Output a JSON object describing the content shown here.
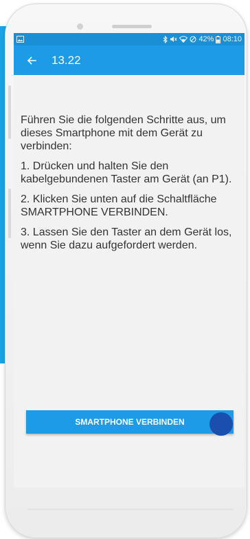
{
  "status_bar": {
    "battery": "42%",
    "time": "08:10",
    "icons": [
      "image-icon",
      "bluetooth-icon",
      "mute-icon",
      "wifi-icon",
      "alarm-off-icon",
      "battery-icon"
    ]
  },
  "app_bar": {
    "back_icon": "arrow-left-icon",
    "title": "13.22"
  },
  "instructions": {
    "intro": "Führen Sie die folgenden Schritte aus, um dieses Smartphone mit dem Gerät zu verbinden:",
    "steps": [
      "1. Drücken und halten Sie den kabelgebundenen Taster am Gerät (an P1).",
      "2. Klicken Sie unten auf die Schaltfläche SMARTPHONE VERBINDEN.",
      "3. Lassen Sie den Taster an dem Gerät los, wenn Sie dazu aufgefordert werden."
    ]
  },
  "connect_button": {
    "label": "SMARTPHONE VERBINDEN"
  },
  "colors": {
    "accent": "#1e9be6",
    "status_bar": "#1b8fd6",
    "touch_indicator": "#1a4fb0",
    "text": "#333333",
    "background": "#f2f2f2"
  }
}
